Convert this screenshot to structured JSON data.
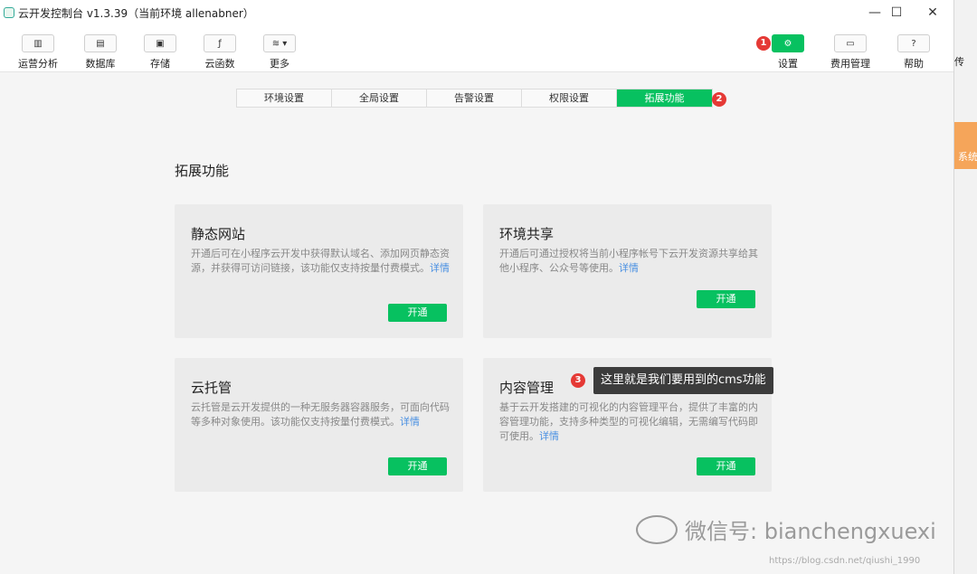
{
  "window": {
    "title": "云开发控制台 v1.3.39（当前环境 allenabner）",
    "controls": [
      "—",
      "☐",
      "✕"
    ]
  },
  "toolbar": {
    "left": [
      {
        "label": "运营分析",
        "icon": "bar-chart-icon",
        "glyph": "▥"
      },
      {
        "label": "数据库",
        "icon": "database-icon",
        "glyph": "▤"
      },
      {
        "label": "存储",
        "icon": "storage-icon",
        "glyph": "▣"
      },
      {
        "label": "云函数",
        "icon": "function-icon",
        "glyph": "ƒ"
      },
      {
        "label": "更多",
        "icon": "layers-icon",
        "glyph": "≋ ▾"
      }
    ],
    "right": [
      {
        "label": "设置",
        "icon": "gear-icon",
        "glyph": "⚙"
      },
      {
        "label": "费用管理",
        "icon": "billing-icon",
        "glyph": "▭"
      },
      {
        "label": "帮助",
        "icon": "help-icon",
        "glyph": "?"
      }
    ]
  },
  "tabs": [
    "环境设置",
    "全局设置",
    "告警设置",
    "权限设置",
    "拓展功能"
  ],
  "active_tab": "拓展功能",
  "badges": [
    "1",
    "2",
    "3"
  ],
  "section_title": "拓展功能",
  "cards": [
    {
      "name": "静态网站",
      "desc": "开通后可在小程序云开发中获得默认域名、添加网页静态资源，并获得可访问链接，该功能仅支持按量付费模式。",
      "link": "详情",
      "button": "开通"
    },
    {
      "name": "环境共享",
      "desc": "开通后可通过授权将当前小程序帐号下云开发资源共享给其他小程序、公众号等使用。",
      "link": "详情",
      "button": "开通"
    },
    {
      "name": "云托管",
      "desc": "云托管是云开发提供的一种无服务器容器服务，可面向代码等多种对象使用。该功能仅支持按量付费模式。",
      "link": "详情",
      "button": "开通"
    },
    {
      "name": "内容管理",
      "desc": "基于云开发搭建的可视化的内容管理平台，提供了丰富的内容管理功能，支持多种类型的可视化编辑，无需编写代码即可使用。",
      "link": "详情",
      "button": "开通"
    }
  ],
  "tooltip": "这里就是我们要用到的cms功能",
  "side": {
    "top_text": "传",
    "orange_text": "系统"
  },
  "watermark": "微信号: bianchengxuexi",
  "blog_url": "https://blog.csdn.net/qiushi_1990",
  "colors": {
    "accent": "#07c160",
    "badge": "#e53935",
    "link": "#4a90e2"
  }
}
